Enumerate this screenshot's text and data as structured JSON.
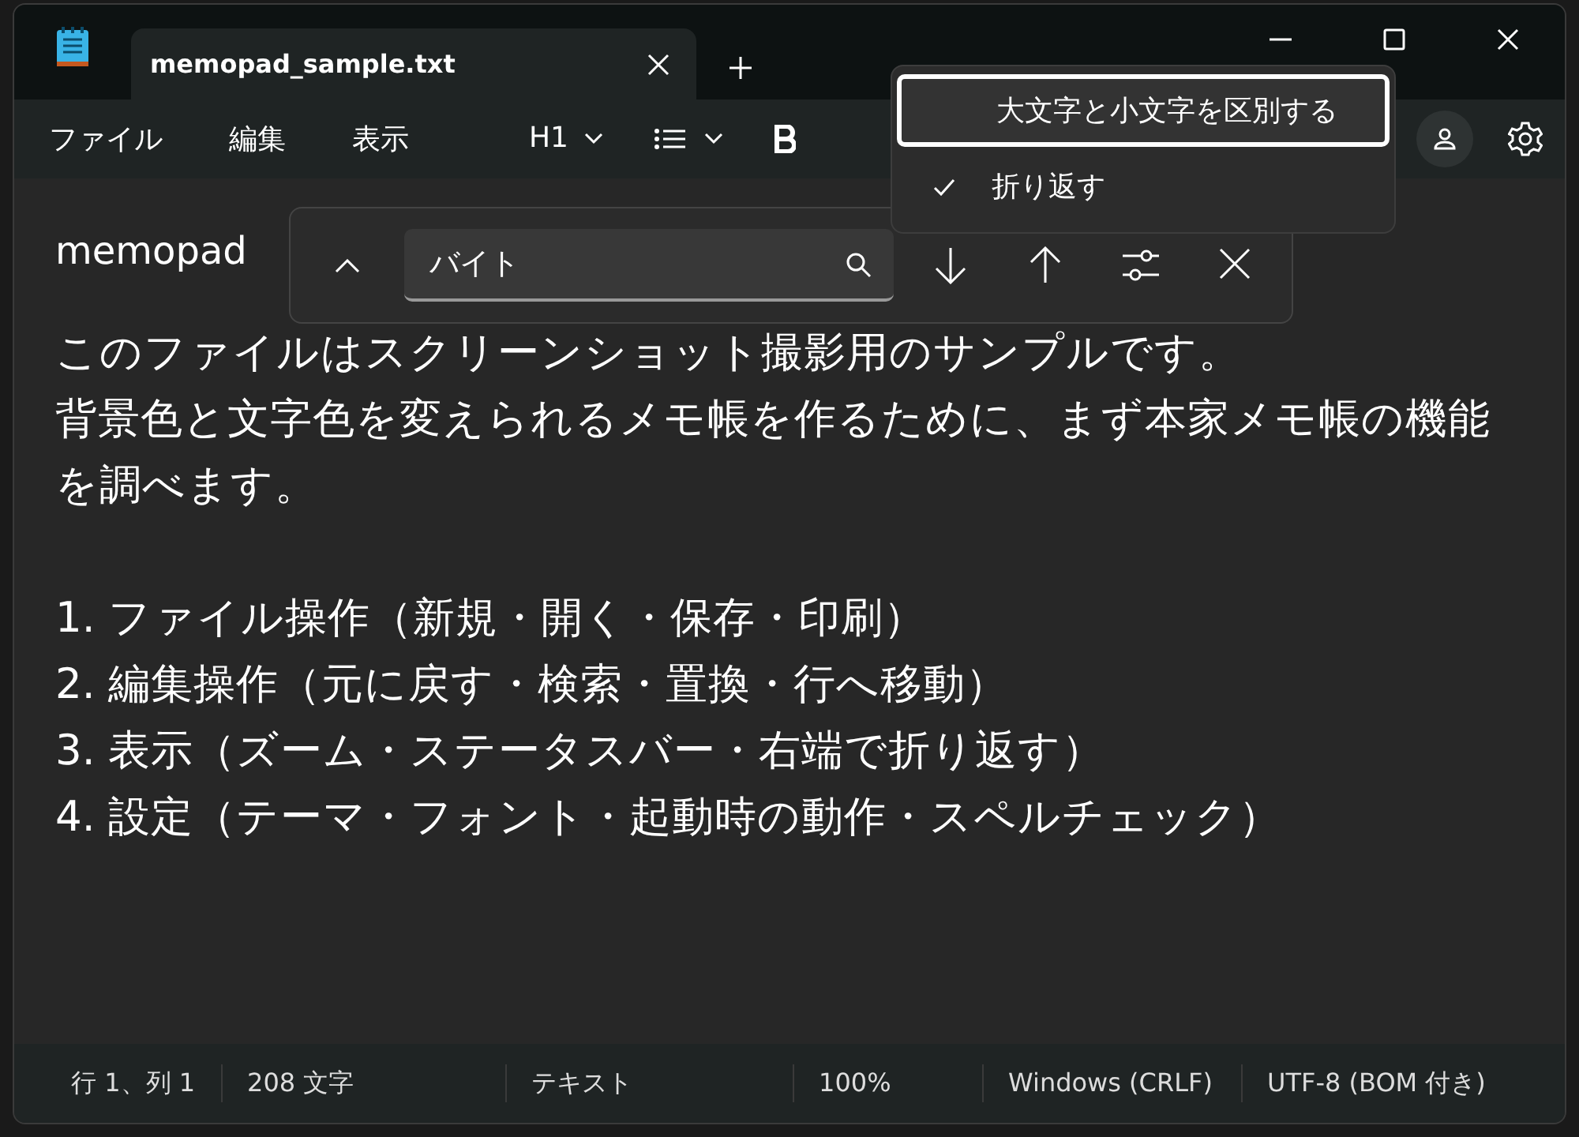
{
  "tab": {
    "title": "memopad_sample.txt",
    "selected": true
  },
  "menus": [
    "ファイル",
    "編集",
    "表示"
  ],
  "toolbar": {
    "heading": "H1"
  },
  "document": {
    "heading": "memopad",
    "paragraphs": [
      [
        "このファイルはスクリーンショット撮影用のサンプルです。",
        "背景色と文字色を変えられるメモ帳を作るために、まず本家メモ帳の機能を調べます。"
      ],
      [
        "1. ファイル操作（新規・開く・保存・印刷）",
        "2. 編集操作（元に戻す・検索・置換・行へ移動）",
        "3. 表示（ズーム・ステータスバー・右端で折り返す）",
        "4. 設定（テーマ・フォント・起動時の動作・スペルチェック）"
      ]
    ]
  },
  "find": {
    "value": "バイト"
  },
  "options_menu": [
    {
      "label": "大文字と小文字を区別する",
      "checked": false,
      "focused": true
    },
    {
      "label": "折り返す",
      "checked": true,
      "focused": false
    }
  ],
  "status_bar": [
    "行 1、列 1",
    "208 文字",
    "テキスト",
    "100%",
    "Windows (CRLF)",
    "UTF-8 (BOM 付き)"
  ]
}
